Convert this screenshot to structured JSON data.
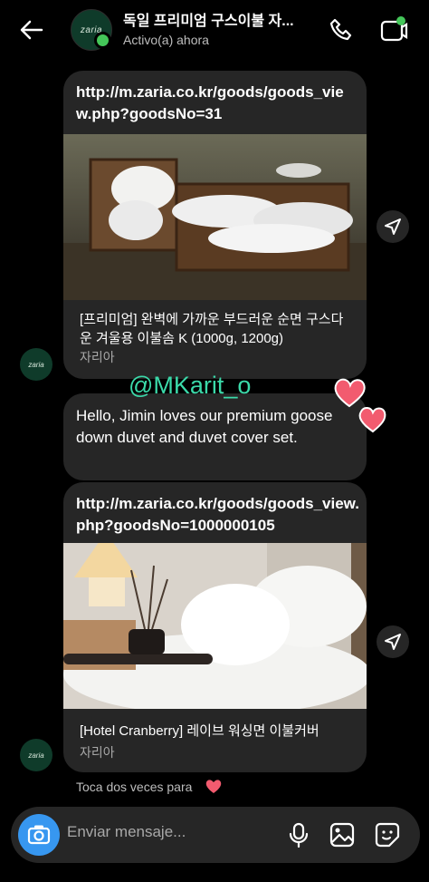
{
  "header": {
    "title": "독일 프리미엄 구스이불 자...",
    "status": "Activo(a) ahora",
    "avatar_logo": "zaria"
  },
  "messages": [
    {
      "type": "link_card",
      "url": "http://m.zaria.co.kr/goods/goods_view.php?goodsNo=31",
      "title": "[프리미엄] 완벽에 가까운 부드러운 순면 구스다운 겨울용 이불솜 K (1000g, 1200g)",
      "source": "자리아"
    },
    {
      "type": "text",
      "text": "Hello, Jimin loves our premium goose down duvet and duvet cover set."
    },
    {
      "type": "link_card",
      "url": "http://m.zaria.co.kr/goods/goods_view.php?goodsNo=1000000105",
      "title": "[Hotel Cranberry] 레이브 워싱면 이불커버",
      "source": "자리아"
    }
  ],
  "watermark": "@MKarit_o",
  "hint": "Toca dos veces para",
  "composer": {
    "placeholder": "Enviar mensaje..."
  },
  "colors": {
    "background": "#000000",
    "bubble": "#262626",
    "accent": "#3797f0",
    "online": "#44c659",
    "watermark": "#3bd9a9",
    "heart": "#f25b6f"
  }
}
